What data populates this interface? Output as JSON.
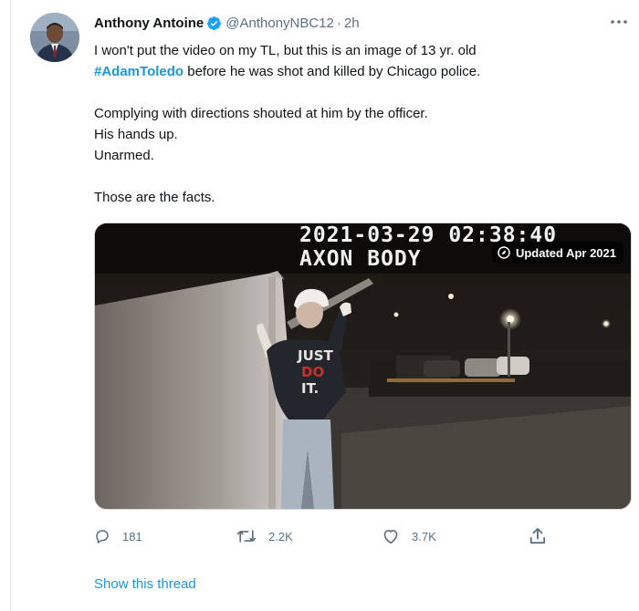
{
  "tweet": {
    "author_name": "Anthony Antoine",
    "handle": "@AnthonyNBC12",
    "separator": "·",
    "time": "2h",
    "lines": {
      "line1": "I won't put the video on my TL, but this is an image of 13 yr. old",
      "hashtag": "#AdamToledo",
      "line2_rest": " before he was shot and killed by Chicago police.",
      "line3": "Complying with directions shouted at him by the officer.",
      "line4": "His hands up.",
      "line5": "Unarmed.",
      "line6": "Those are the facts."
    },
    "media": {
      "overlay_date": "2021-03-29 02:38:40",
      "overlay_text": "AXON BODY",
      "badge": "Updated Apr 2021"
    },
    "actions": {
      "replies": "181",
      "retweets": "2.2K",
      "likes": "3.7K"
    },
    "show_thread": "Show this thread"
  },
  "icons": {
    "verified": "verified-badge-icon",
    "more": "more-icon",
    "reply": "reply-icon",
    "retweet": "retweet-icon",
    "like": "heart-icon",
    "share": "share-icon",
    "updated": "compass-icon"
  },
  "colors": {
    "link": "#1b95e0",
    "secondary": "#5b7083",
    "verified": "#1da1f2"
  }
}
